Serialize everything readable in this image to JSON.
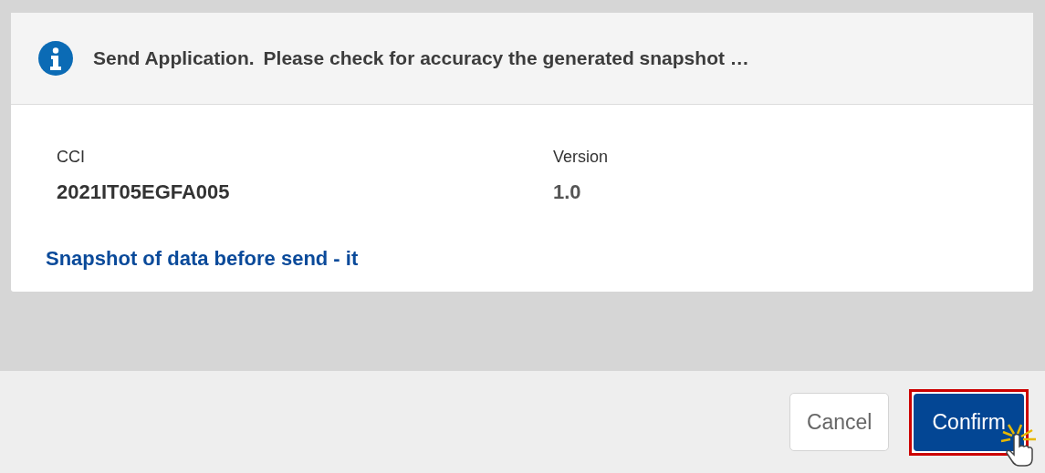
{
  "dialog": {
    "title": "Send Application.",
    "message": "Please check for accuracy the generated snapshot …",
    "fields": [
      {
        "label": "CCI",
        "value": "2021IT05EGFA005"
      },
      {
        "label": "Version",
        "value": "1.0"
      }
    ],
    "link": "Snapshot of data before send - it"
  },
  "footer": {
    "buttons": [
      {
        "label": "Cancel",
        "kind": "secondary",
        "highlighted": false
      },
      {
        "label": "Confirm",
        "kind": "primary",
        "highlighted": true
      }
    ]
  }
}
